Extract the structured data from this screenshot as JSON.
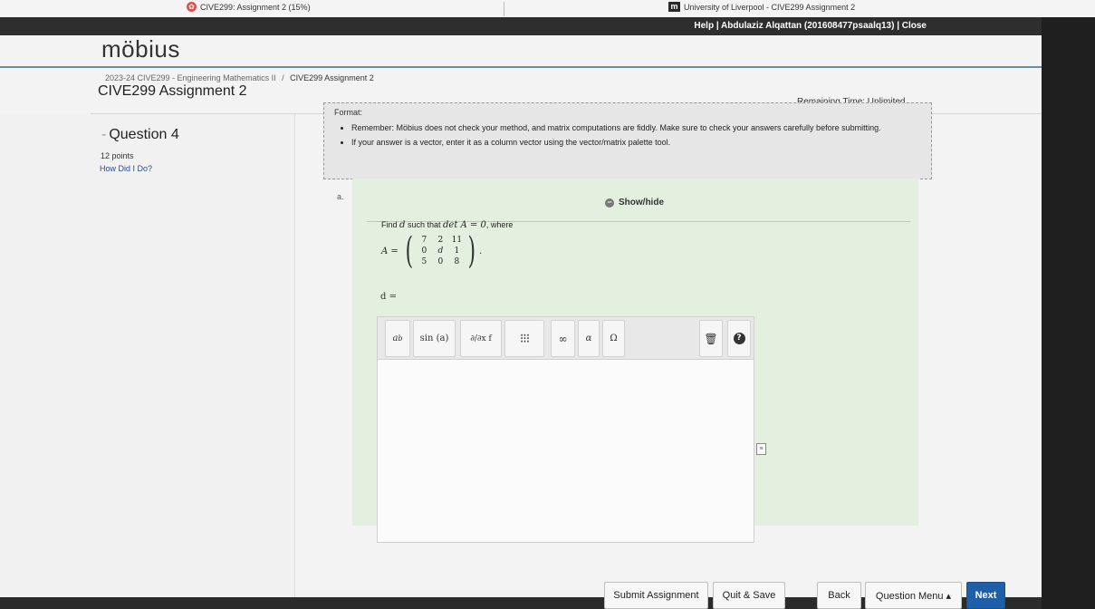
{
  "browser": {
    "tabs": [
      {
        "icon": "mobius-icon",
        "label": "CIVE299: Assignment 2 (15%)"
      },
      {
        "icon": "m-logo-icon",
        "label": "University of Liverpool - CIVE299 Assignment 2"
      }
    ]
  },
  "header": {
    "user_links": "Help | Abdulaziz Alqattan (201608477psaalq13) | Close",
    "logo": "möbius"
  },
  "breadcrumb": {
    "course": "2023-24 CIVE299 - Engineering Mathematics II",
    "separator": "/",
    "current": "CIVE299 Assignment 2"
  },
  "assignment": {
    "title": "CIVE299 Assignment 2",
    "remaining_time": "Remaining Time: Unlimited"
  },
  "question": {
    "title": "Question 4",
    "points": "12 points",
    "how_did_i_do": "How Did I Do?"
  },
  "format": {
    "label": "Format:",
    "items": [
      "Remember: Möbius does not check your method, and matrix computations are fiddly. Make sure to check your answers carefully before submitting.",
      "If your answer is a vector, enter it as a column vector using the vector/matrix palette tool."
    ]
  },
  "part": {
    "label": "a.",
    "show_hide": "Show/hide",
    "prompt_pre": "Find",
    "prompt_var": "d",
    "prompt_mid": "such that",
    "prompt_math": "det A = 0",
    "prompt_post": ", where",
    "matrix_lhs": "A =",
    "matrix": [
      [
        "7",
        "2",
        "11"
      ],
      [
        "0",
        "d",
        "1"
      ],
      [
        "5",
        "0",
        "8"
      ]
    ],
    "matrix_end": ".",
    "answer_label": "d ="
  },
  "editor": {
    "toolbar": {
      "power": "ab",
      "sin": "sin (a)",
      "partial": "∂/∂x f",
      "matrix": "⁝⁝⁝",
      "infinity": "∞",
      "alpha": "α",
      "omega": "Ω",
      "trash_icon": "trash-icon",
      "help_icon": "help-icon"
    },
    "answer_value": ""
  },
  "buttons": {
    "submit": "Submit Assignment",
    "quit": "Quit & Save",
    "back": "Back",
    "question_menu": "Question Menu ▴",
    "next": "Next"
  },
  "colors": {
    "header_dark": "#2e2e2e",
    "part_background": "#e3f0df",
    "link": "#2a4a8a",
    "next_button": "#1f5fa8"
  }
}
